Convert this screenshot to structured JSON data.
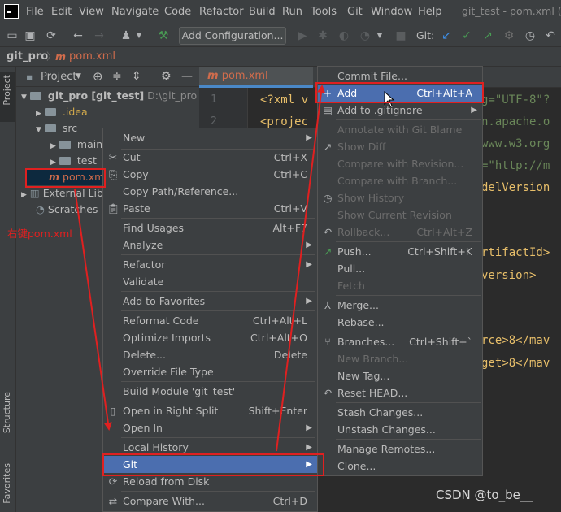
{
  "menubar": {
    "items": [
      "File",
      "Edit",
      "View",
      "Navigate",
      "Code",
      "Refactor",
      "Build",
      "Run",
      "Tools",
      "Git",
      "Window",
      "Help"
    ],
    "window_title": "git_test - pom.xml (git"
  },
  "toolbar": {
    "config_label": "Add Configuration...",
    "git_label": "Git:"
  },
  "breadcrumb": {
    "project": "git_pro",
    "file": "pom.xml"
  },
  "left_strip": {
    "project": "Project",
    "structure": "Structure",
    "favorites": "Favorites"
  },
  "project_panel": {
    "title": "Project",
    "tree": [
      {
        "label": "git_pro [git_test]",
        "extra": "D:\\git_pro"
      },
      {
        "label": ".idea"
      },
      {
        "label": "src"
      },
      {
        "label": "main"
      },
      {
        "label": "test"
      },
      {
        "label": "pom.xml"
      },
      {
        "label": "External Libraries"
      },
      {
        "label": "Scratches and Consoles"
      }
    ]
  },
  "editor": {
    "tab_label": "pom.xml (git_test)",
    "line_numbers": [
      "1",
      "2"
    ],
    "lines": [
      "<?xml v",
      "<projec",
      "",
      "",
      "",
      "",
      "",
      "",
      "",
      ""
    ],
    "right_fragments": [
      "g=\"UTF-8\"?",
      "n.apache.o",
      "www.w3.org",
      "=\"http://m",
      "delVersion",
      "rtifactId>",
      "version>",
      "rce>8</mav",
      "get>8</mav"
    ]
  },
  "context_menu": {
    "items": [
      {
        "label": "New",
        "shortcut": ""
      },
      {
        "label": "Cut",
        "shortcut": "Ctrl+X"
      },
      {
        "label": "Copy",
        "shortcut": "Ctrl+C"
      },
      {
        "label": "Copy Path/Reference...",
        "shortcut": ""
      },
      {
        "label": "Paste",
        "shortcut": "Ctrl+V"
      },
      {
        "label": "Find Usages",
        "shortcut": "Alt+F7"
      },
      {
        "label": "Analyze",
        "shortcut": ""
      },
      {
        "label": "Refactor",
        "shortcut": ""
      },
      {
        "label": "Validate",
        "shortcut": ""
      },
      {
        "label": "Add to Favorites",
        "shortcut": ""
      },
      {
        "label": "Reformat Code",
        "shortcut": "Ctrl+Alt+L"
      },
      {
        "label": "Optimize Imports",
        "shortcut": "Ctrl+Alt+O"
      },
      {
        "label": "Delete...",
        "shortcut": "Delete"
      },
      {
        "label": "Override File Type",
        "shortcut": ""
      },
      {
        "label": "Build Module 'git_test'",
        "shortcut": ""
      },
      {
        "label": "Open in Right Split",
        "shortcut": "Shift+Enter"
      },
      {
        "label": "Open In",
        "shortcut": ""
      },
      {
        "label": "Local History",
        "shortcut": ""
      },
      {
        "label": "Git",
        "shortcut": ""
      },
      {
        "label": "Reload from Disk",
        "shortcut": ""
      },
      {
        "label": "Compare With...",
        "shortcut": "Ctrl+D"
      }
    ]
  },
  "git_menu": {
    "items": [
      {
        "label": "Commit File...",
        "shortcut": ""
      },
      {
        "label": "Add",
        "shortcut": "Ctrl+Alt+A"
      },
      {
        "label": "Add to .gitignore",
        "shortcut": ""
      },
      {
        "label": "Annotate with Git Blame",
        "shortcut": ""
      },
      {
        "label": "Show Diff",
        "shortcut": ""
      },
      {
        "label": "Compare with Revision...",
        "shortcut": ""
      },
      {
        "label": "Compare with Branch...",
        "shortcut": ""
      },
      {
        "label": "Show History",
        "shortcut": ""
      },
      {
        "label": "Show Current Revision",
        "shortcut": ""
      },
      {
        "label": "Rollback...",
        "shortcut": "Ctrl+Alt+Z"
      },
      {
        "label": "Push...",
        "shortcut": "Ctrl+Shift+K"
      },
      {
        "label": "Pull...",
        "shortcut": ""
      },
      {
        "label": "Fetch",
        "shortcut": ""
      },
      {
        "label": "Merge...",
        "shortcut": ""
      },
      {
        "label": "Rebase...",
        "shortcut": ""
      },
      {
        "label": "Branches...",
        "shortcut": "Ctrl+Shift+`"
      },
      {
        "label": "New Branch...",
        "shortcut": ""
      },
      {
        "label": "New Tag...",
        "shortcut": ""
      },
      {
        "label": "Reset HEAD...",
        "shortcut": ""
      },
      {
        "label": "Stash Changes...",
        "shortcut": ""
      },
      {
        "label": "Unstash Changes...",
        "shortcut": ""
      },
      {
        "label": "Manage Remotes...",
        "shortcut": ""
      },
      {
        "label": "Clone...",
        "shortcut": ""
      }
    ]
  },
  "annotation": {
    "text": "右键pom.xml"
  },
  "watermark": {
    "text": "CSDN @to_be__"
  },
  "colors": {
    "accent": "#4b6eaf",
    "highlight": "#e02020",
    "xml_file": "#d06c4c"
  }
}
